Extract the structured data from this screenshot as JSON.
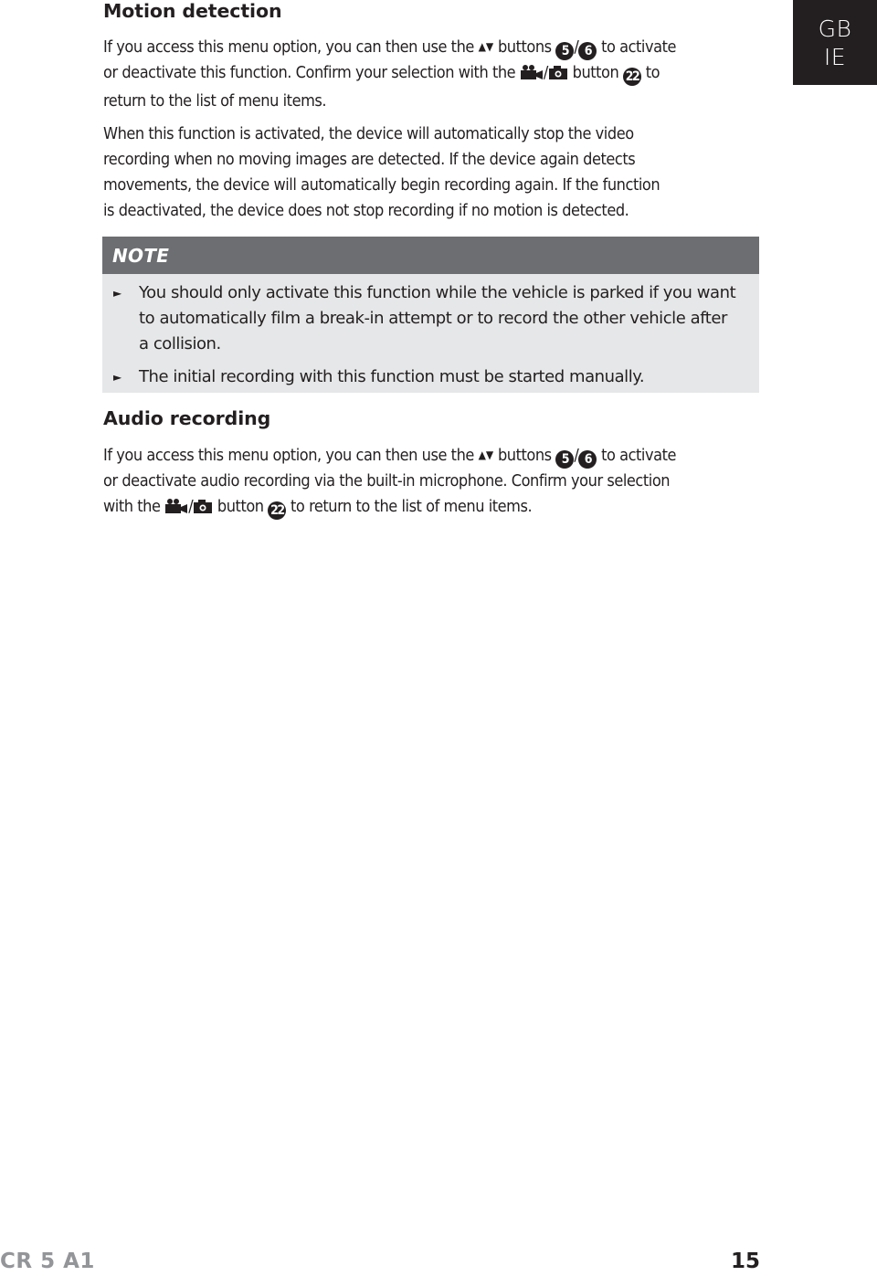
{
  "language_tab": {
    "line1": "GB",
    "line2": "IE"
  },
  "section_motion": {
    "heading": "Motion detection",
    "para1": {
      "l1_a": "If you access this menu option, you can then use the",
      "l1_arrows": "▲▼",
      "l1_b": "buttons",
      "badge_up": "5",
      "slash": "/",
      "badge_down": "6",
      "l1_c": "to activate",
      "l2_a": "or deactivate this function. Confirm your selection with the",
      "l2_b": "button",
      "badge_confirm": "22",
      "l2_c": "to",
      "l3": "return to the list of menu items."
    },
    "para2": [
      "When this function is activated, the device will automatically stop the video",
      "recording when no moving images are detected. If the device again detects",
      "movements, the device will automatically begin recording again. If the function",
      "is deactivated, the device does not stop recording if no motion is detected."
    ]
  },
  "note": {
    "title": "NOTE",
    "bullet_glyph": "►",
    "items": [
      {
        "lines": [
          "You should only activate this function while the vehicle is parked if you want",
          "to automatically film a break-in attempt or to record the other vehicle after",
          "a collision."
        ]
      },
      {
        "lines": [
          "The initial recording with this function must be started manually."
        ]
      }
    ]
  },
  "section_audio": {
    "heading": "Audio recording",
    "para": {
      "l1_a": "If you access this menu option, you can then use the",
      "l1_arrows": "▲▼",
      "l1_b": "buttons",
      "badge_up": "5",
      "slash": "/",
      "badge_down": "6",
      "l1_c": "to activate",
      "l2": "or deactivate audio recording via the built-in microphone. Confirm your selection",
      "l3_a": "with the",
      "l3_b": "button",
      "badge_confirm": "22",
      "l3_c": "to return to the list of menu items."
    }
  },
  "footer": {
    "model": "CR 5 A1",
    "page_number": "15"
  }
}
